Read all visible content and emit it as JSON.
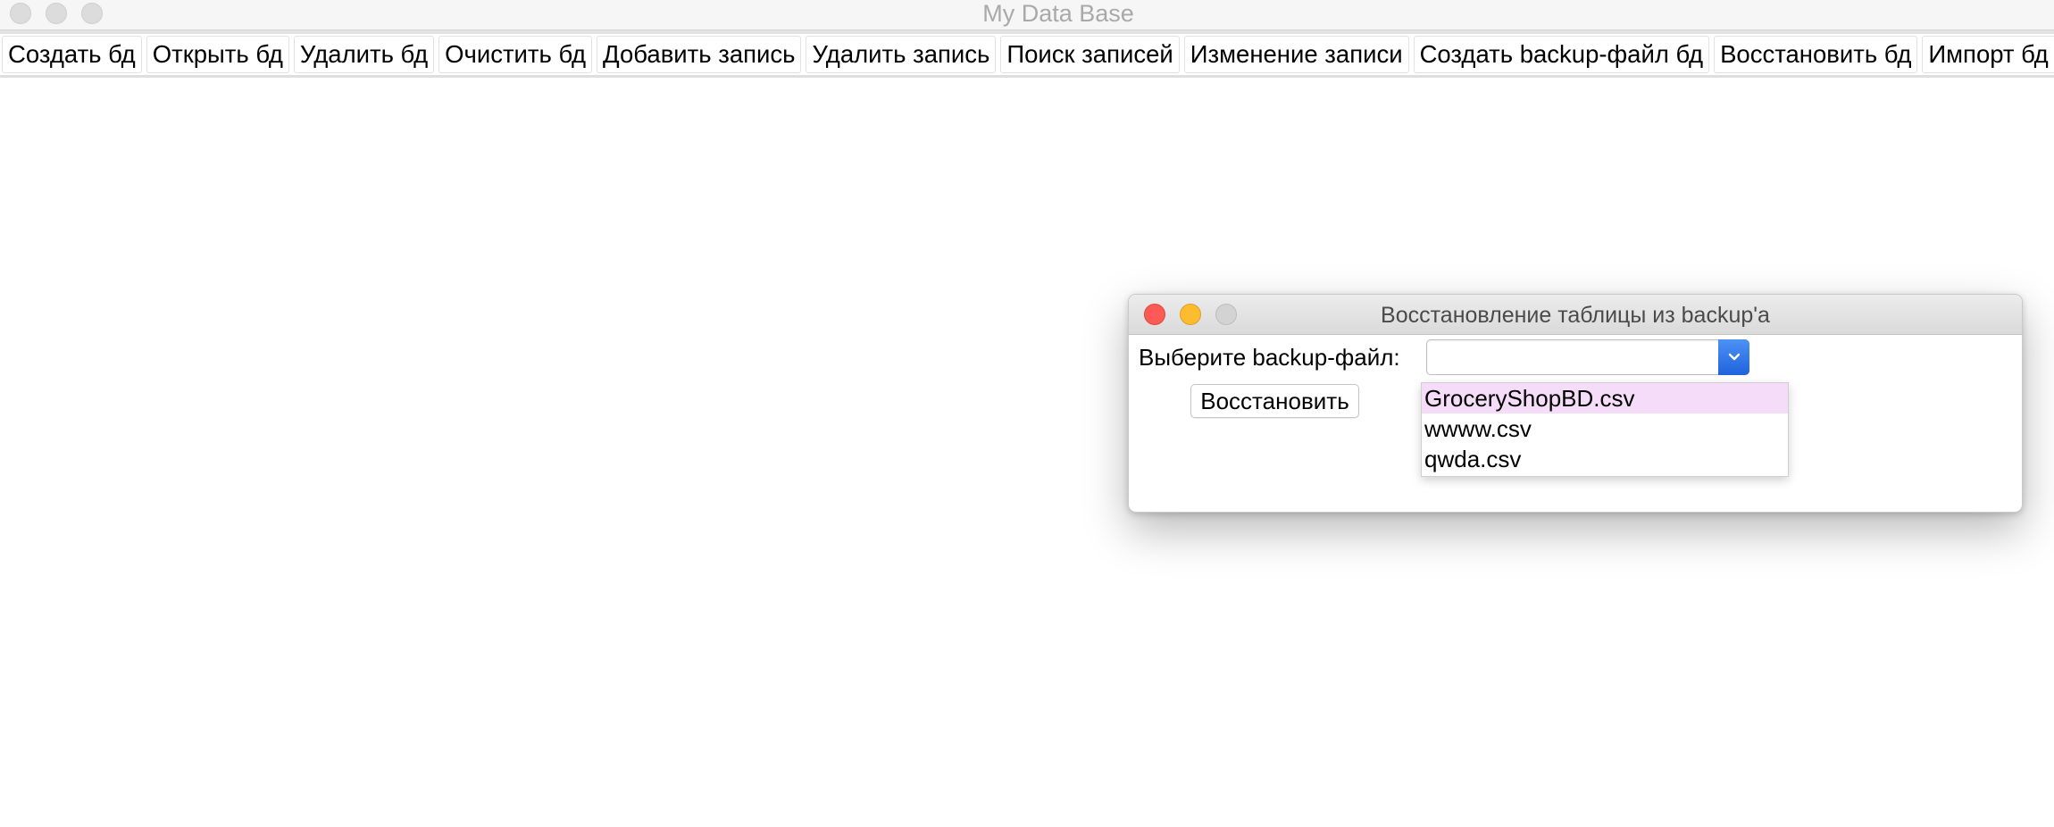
{
  "window": {
    "title": "My Data Base"
  },
  "toolbar": {
    "buttons": [
      "Создать бд",
      "Открыть бд",
      "Удалить бд",
      "Очистить бд",
      "Добавить запись",
      "Удалить запись",
      "Поиск записей",
      "Изменение записи",
      "Создать backup-файл бд",
      "Восстановить бд",
      "Импорт бд в"
    ]
  },
  "dialog": {
    "title": "Восстановление таблицы из backup'а",
    "label": "Выберите backup-файл:",
    "combo_value": "",
    "restore_label": "Восстановить",
    "options": [
      "GroceryShopBD.csv",
      "wwww.csv",
      "qwda.csv"
    ],
    "selected_index": 0,
    "colors": {
      "accent": "#2b6fe6",
      "selection": "#f5dcf8",
      "close": "#fd5a55",
      "minimize": "#fdbb2e"
    }
  }
}
